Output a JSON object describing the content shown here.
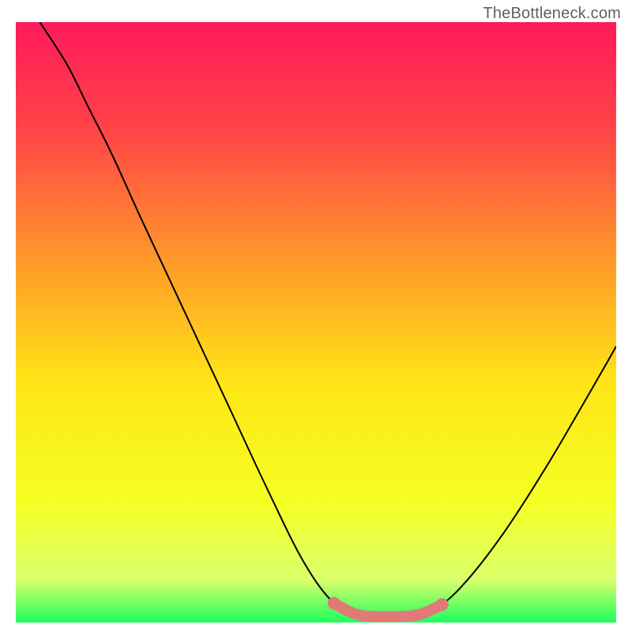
{
  "watermark": "TheBottleneck.com",
  "chart_data": {
    "type": "line",
    "title": "",
    "xlabel": "",
    "ylabel": "",
    "xlim": [
      0,
      100
    ],
    "ylim": [
      0,
      100
    ],
    "grid": false,
    "legend": false,
    "background_gradient": {
      "stops": [
        {
          "offset": 0,
          "color": "#ff1a5b"
        },
        {
          "offset": 18,
          "color": "#ff4446"
        },
        {
          "offset": 40,
          "color": "#ff9a2a"
        },
        {
          "offset": 60,
          "color": "#ffe516"
        },
        {
          "offset": 80,
          "color": "#f5ff24"
        },
        {
          "offset": 93,
          "color": "#d8ff6c"
        },
        {
          "offset": 100,
          "color": "#1eff5c"
        }
      ]
    },
    "series": [
      {
        "name": "bottleneck-curve",
        "color": "#000000",
        "style": "line",
        "points": [
          {
            "x": 4,
            "y": 100
          },
          {
            "x": 8.5,
            "y": 93
          },
          {
            "x": 12,
            "y": 86
          },
          {
            "x": 16,
            "y": 78
          },
          {
            "x": 21,
            "y": 67
          },
          {
            "x": 28,
            "y": 52
          },
          {
            "x": 35,
            "y": 37
          },
          {
            "x": 42,
            "y": 22
          },
          {
            "x": 48,
            "y": 10
          },
          {
            "x": 53,
            "y": 3.2
          },
          {
            "x": 57,
            "y": 1.3
          },
          {
            "x": 62,
            "y": 1.0
          },
          {
            "x": 67,
            "y": 1.3
          },
          {
            "x": 71,
            "y": 3.0
          },
          {
            "x": 76,
            "y": 8
          },
          {
            "x": 82,
            "y": 16
          },
          {
            "x": 89,
            "y": 27
          },
          {
            "x": 96,
            "y": 39
          },
          {
            "x": 100,
            "y": 46
          }
        ]
      },
      {
        "name": "highlight-band",
        "color": "#e07a78",
        "style": "thick-line",
        "points": [
          {
            "x": 53,
            "y": 3.2
          },
          {
            "x": 57,
            "y": 1.3
          },
          {
            "x": 62,
            "y": 1.0
          },
          {
            "x": 67,
            "y": 1.3
          },
          {
            "x": 71,
            "y": 3.0
          }
        ]
      }
    ],
    "annotations": []
  }
}
